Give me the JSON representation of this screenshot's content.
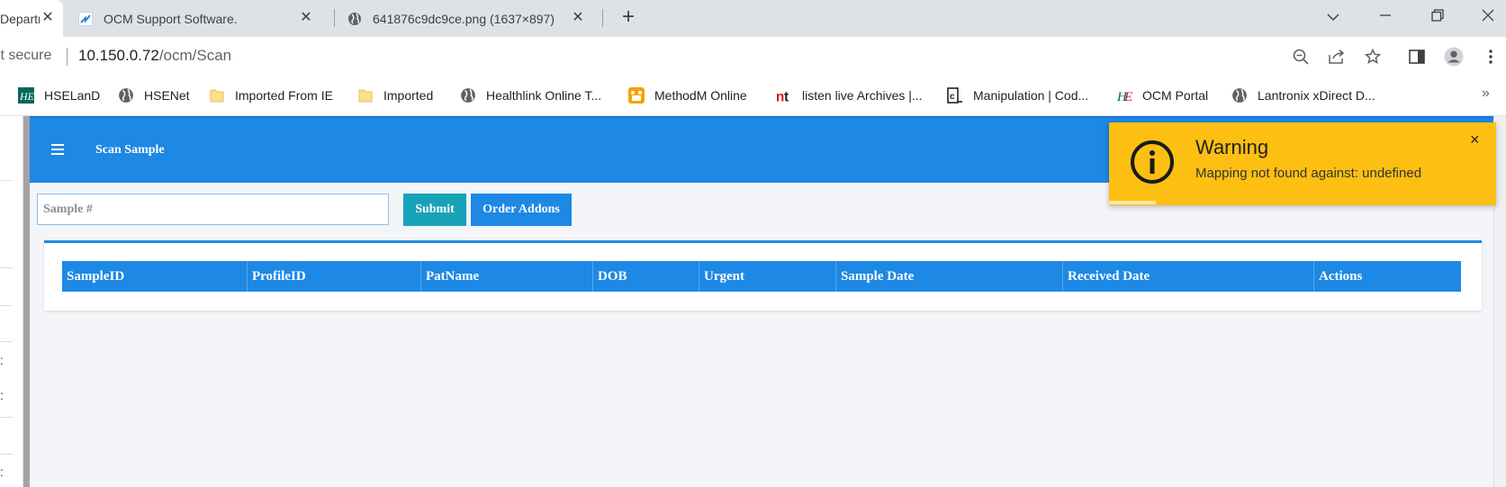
{
  "browser": {
    "tabs": [
      {
        "title": "Departm",
        "icon": "hse-icon"
      },
      {
        "title": "OCM Support Software.",
        "icon": "ocm-icon"
      },
      {
        "title": "641876c9dc9ce.png (1637×897)",
        "icon": "globe-icon"
      }
    ],
    "new_tab_symbol": "+",
    "address": {
      "security_label": "Not secure",
      "url_host": "10.150.0.72",
      "url_path": "/ocm/Scan"
    },
    "bookmarks": [
      {
        "label": "HSELanD",
        "icon": "hse-icon"
      },
      {
        "label": "HSENet",
        "icon": "globe-icon"
      },
      {
        "label": "Imported From IE",
        "icon": "folder-icon"
      },
      {
        "label": "Imported",
        "icon": "folder-icon"
      },
      {
        "label": "Healthlink Online T...",
        "icon": "globe-icon"
      },
      {
        "label": "MethodM Online",
        "icon": "methodm-icon"
      },
      {
        "label": "listen live Archives |...",
        "icon": "nt-icon"
      },
      {
        "label": "Manipulation | Cod...",
        "icon": "code-icon"
      },
      {
        "label": "OCM Portal",
        "icon": "hse-icon"
      },
      {
        "label": "Lantronix xDirect D...",
        "icon": "globe-icon"
      }
    ],
    "bookmarks_more": "»"
  },
  "app": {
    "header": {
      "title": "Scan Sample"
    },
    "search": {
      "placeholder": "Sample #",
      "value": ""
    },
    "buttons": {
      "submit": "Submit",
      "order_addons": "Order Addons"
    },
    "table": {
      "columns": [
        "SampleID",
        "ProfileID",
        "PatName",
        "DOB",
        "Urgent",
        "Sample Date",
        "Received Date",
        "Actions"
      ],
      "rows": []
    }
  },
  "toast": {
    "title": "Warning",
    "message": "Mapping not found against: undefined",
    "close_symbol": "×",
    "progress": 0.12,
    "color": "#fdbf11"
  },
  "colors": {
    "primary": "#1e88e5",
    "info": "#17a2b8",
    "warning": "#fdbf11"
  }
}
